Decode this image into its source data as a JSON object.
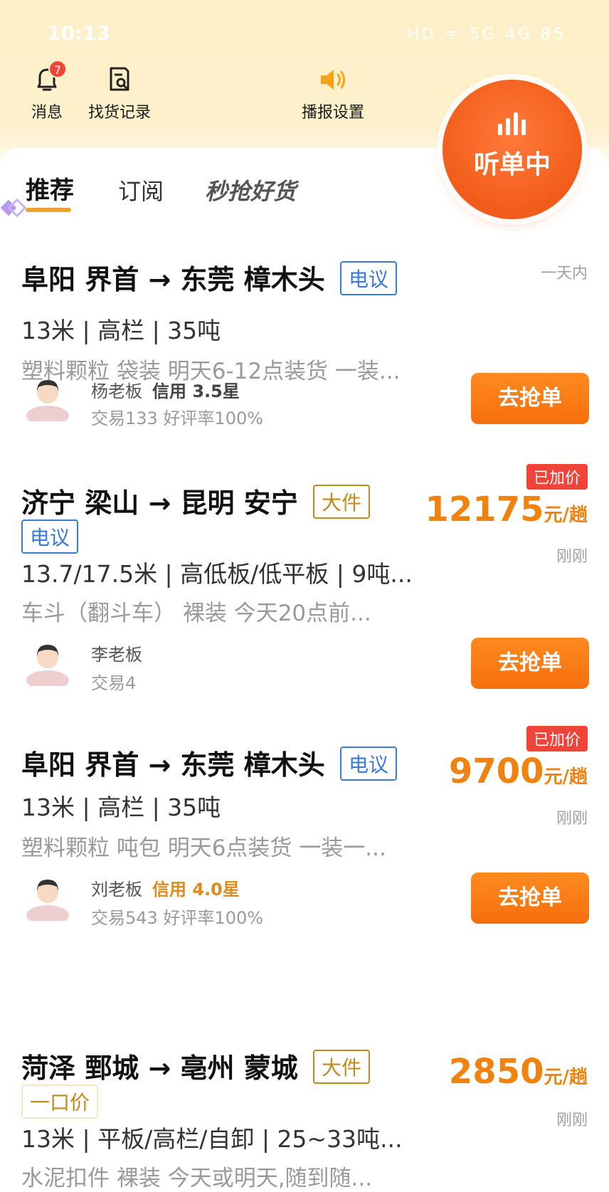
{
  "status": {
    "time": "10:13",
    "right": "HD ᯤ 5G 4G 85"
  },
  "topbar": {
    "messages": {
      "label": "消息",
      "badge": "7"
    },
    "history": {
      "label": "找货记录"
    },
    "broadcast": {
      "label": "播报设置"
    },
    "listen": {
      "label": "听单中"
    }
  },
  "tabs": {
    "recommend": "推荐",
    "subscribe": "订阅",
    "flash": "秒抢好货"
  },
  "cards": [
    {
      "from": "阜阳 界首",
      "arrow": "→",
      "to": "东莞 樟木头",
      "tag": "电议",
      "time": "一天内",
      "spec": "13米 | 高栏 | 35吨",
      "desc": "塑料颗粒 袋装 明天6-12点装货 一装...",
      "owner": "杨老板",
      "credit": "信用 3.5星",
      "trade": "交易133 好评率100%",
      "grab": "去抢单"
    },
    {
      "from": "济宁 梁山",
      "arrow": "→",
      "to": "昆明 安宁",
      "tag": "大件",
      "tag2": "电议",
      "raised": "已加价",
      "price": "12175",
      "unit": "元/趟",
      "time": "刚刚",
      "spec": "13.7/17.5米 | 高低板/低平板 | 9吨...",
      "desc": "车斗（翻斗车） 裸装 今天20点前...",
      "owner": "李老板",
      "trade": "交易4",
      "grab": "去抢单"
    },
    {
      "from": "阜阳 界首",
      "arrow": "→",
      "to": "东莞 樟木头",
      "tag": "电议",
      "raised": "已加价",
      "price": "9700",
      "unit": "元/趟",
      "time": "刚刚",
      "spec": "13米 | 高栏 | 35吨",
      "desc": "塑料颗粒 吨包 明天6点装货 一装一...",
      "owner": "刘老板",
      "credit": "信用 4.0星",
      "trade": "交易543 好评率100%",
      "grab": "去抢单"
    },
    {
      "from": "菏泽 鄄城",
      "arrow": "→",
      "to": "亳州 蒙城",
      "tag": "大件",
      "tag2": "一口价",
      "price": "2850",
      "unit": "元/趟",
      "time": "刚刚",
      "spec": "13米 | 平板/高栏/自卸 | 25~33吨...",
      "desc": "水泥扣件 裸装 今天或明天,随到随..."
    }
  ],
  "colors": {
    "accent": "#f56f0e",
    "price": "#f0820f",
    "tag_blue": "#3a7bd5",
    "tag_gold": "#c08a1c",
    "raised": "#f04438"
  }
}
